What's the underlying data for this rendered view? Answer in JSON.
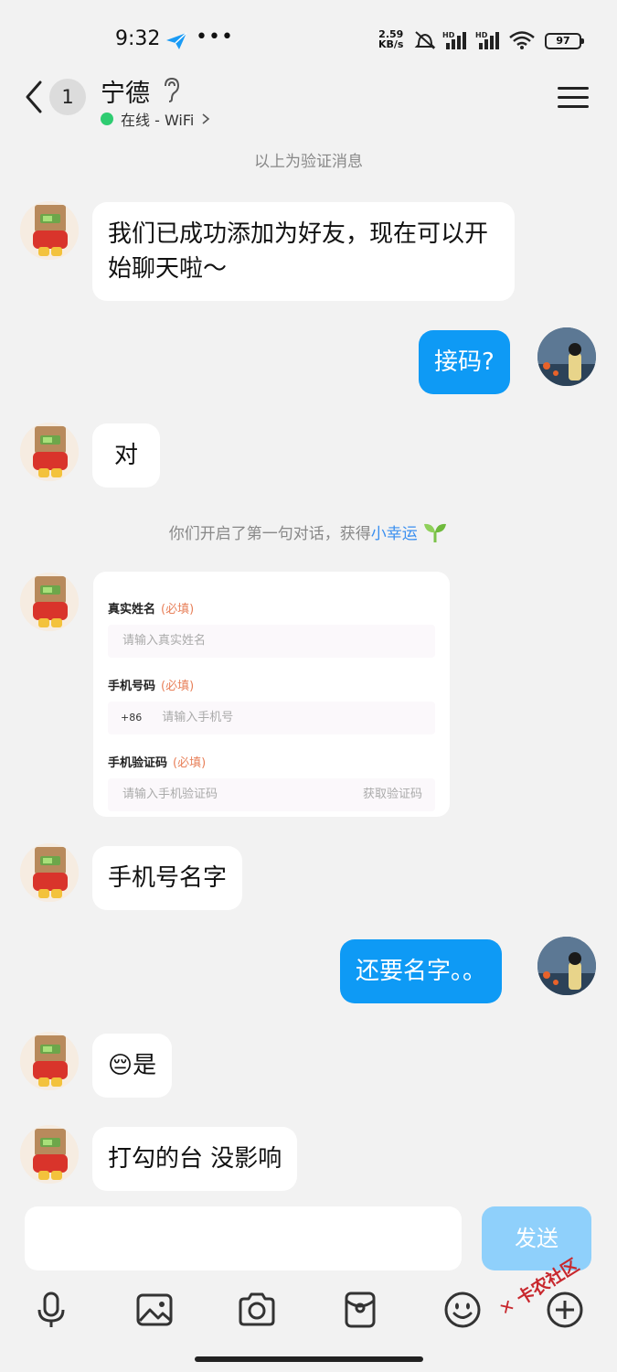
{
  "status_bar": {
    "time": "9:32",
    "dots": "•••",
    "net_speed_value": "2.59",
    "net_speed_unit": "KB/s",
    "battery": "97"
  },
  "header": {
    "unread_count": "1",
    "contact_name": "宁德",
    "online_status": "在线 - WiFi"
  },
  "system": {
    "verify_notice": "以上为验证消息",
    "first_chat_prefix": "你们开启了第一句对话，获得",
    "first_chat_link": "小幸运"
  },
  "messages": {
    "m1": "我们已成功添加为好友，现在可以开始聊天啦～",
    "m2": "接码?",
    "m3": "对",
    "m4": "手机号名字",
    "m5": "还要名字。。",
    "m6": "😔是",
    "m7": "打勾的台 没影响"
  },
  "form_card": {
    "name_label": "真实姓名",
    "name_required": "(必填)",
    "name_placeholder": "请输入真实姓名",
    "phone_label": "手机号码",
    "phone_required": "(必填)",
    "phone_prefix": "+86",
    "phone_placeholder": "请输入手机号",
    "code_label": "手机验证码",
    "code_required": "(必填)",
    "code_placeholder": "请输入手机验证码",
    "get_code": "获取验证码"
  },
  "input_bar": {
    "send_label": "发送"
  },
  "toolbar": {
    "icons": [
      "microphone-icon",
      "image-icon",
      "camera-icon",
      "red-packet-icon",
      "emoji-icon",
      "plus-icon"
    ]
  },
  "watermark": {
    "text": "卡农社区"
  },
  "colors": {
    "accent_blue": "#0e9af5",
    "send_disabled": "#8fd0fb",
    "online_green": "#2ecc71",
    "required_orange": "#e8805a",
    "link_blue": "#3a8ff0"
  }
}
